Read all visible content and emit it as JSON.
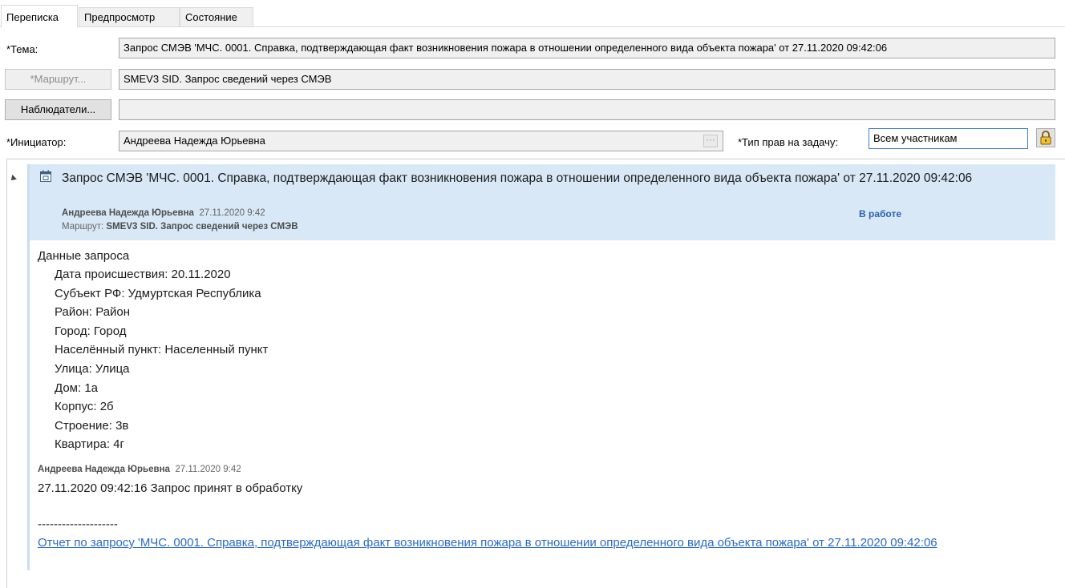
{
  "tabs": [
    {
      "label": "Переписка",
      "active": true
    },
    {
      "label": "Предпросмотр",
      "active": false
    },
    {
      "label": "Состояние",
      "active": false
    }
  ],
  "form": {
    "subject_label": "*Тема:",
    "subject_value": "Запрос СМЭВ 'МЧС. 0001. Справка, подтверждающая факт возникновения пожара в отношении определенного вида объекта пожара' от 27.11.2020 09:42:06",
    "route_button": "*Маршрут...",
    "route_value": "SMEV3 SID. Запрос сведений через СМЭВ",
    "observers_button": "Наблюдатели...",
    "observers_value": "",
    "initiator_label": "*Инициатор:",
    "initiator_value": "Андреева Надежда Юрьевна",
    "initiator_more": "···",
    "rights_label": "*Тип прав на задачу:",
    "rights_value": "Всем участникам"
  },
  "message": {
    "title": "Запрос СМЭВ 'МЧС. 0001. Справка, подтверждающая факт возникновения пожара в отношении определенного вида объекта пожара' от 27.11.2020 09:42:06",
    "author": "Андреева Надежда Юрьевна",
    "date": "27.11.2020 9:42",
    "route_prefix": "Маршрут:",
    "route": "SMEV3 SID. Запрос сведений через СМЭВ",
    "status": "В работе"
  },
  "request": {
    "heading": "Данные запроса",
    "fields": [
      "Дата происшествия: 20.11.2020",
      "Субъект РФ: Удмуртская Республика",
      "Район: Район",
      "Город: Город",
      "Населённый пункт: Населенный пункт",
      "Улица: Улица",
      "Дом: 1а",
      "Корпус: 2б",
      "Строение: 3в",
      "Квартира: 4г"
    ]
  },
  "reply": {
    "author": "Андреева Надежда Юрьевна",
    "date": "27.11.2020 9:42",
    "text": "27.11.2020 09:42:16 Запрос принят в обработку",
    "separator": "--------------------",
    "link": "Отчет по запросу 'МЧС. 0001. Справка, подтверждающая факт возникновения пожара в отношении определенного вида объекта пожара' от 27.11.2020 09:42:06"
  },
  "colors": {
    "header_bg": "#d8e8f6",
    "status": "#2962b5",
    "link": "#2a6ac8",
    "accent": "#c9ddf0"
  }
}
